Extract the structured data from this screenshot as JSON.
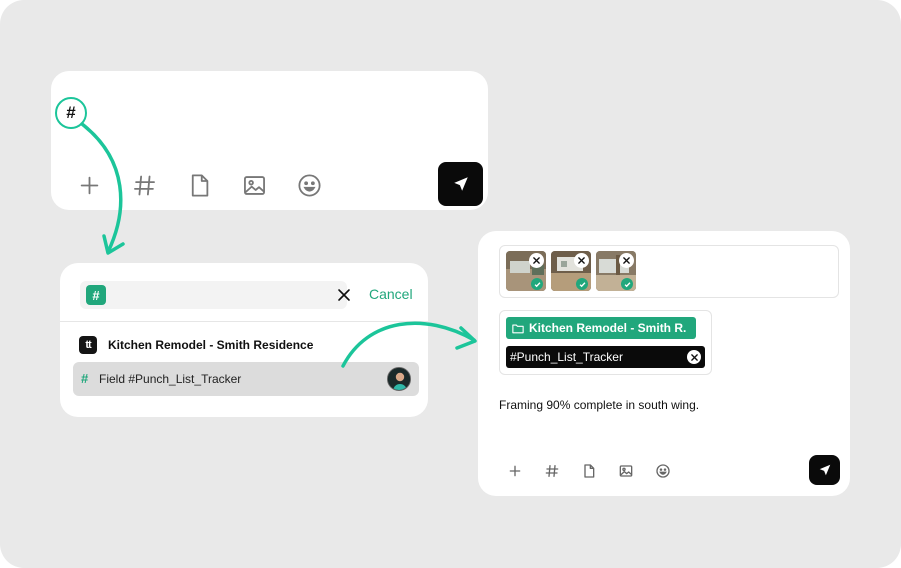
{
  "composer": {
    "trigger_symbol": "#",
    "toolbar": [
      "plus-icon",
      "hash-icon",
      "file-icon",
      "image-icon",
      "emoji-icon"
    ],
    "send_icon": "send-icon"
  },
  "search": {
    "hash_symbol": "#",
    "query": "",
    "placeholder": "",
    "cancel_label": "Cancel",
    "project": {
      "logo_text": "tt",
      "name": "Kitchen Remodel - Smith Residence"
    },
    "result": {
      "hash_symbol": "#",
      "label": "Field #Punch_List_Tracker"
    }
  },
  "message": {
    "attachments": [
      {
        "type": "photo",
        "status": "uploaded"
      },
      {
        "type": "photo",
        "status": "uploaded"
      },
      {
        "type": "photo",
        "status": "uploaded"
      }
    ],
    "project_tag": "Kitchen Remodel - Smith R.",
    "tracker_tag": "#Punch_List_Tracker",
    "text": "Framing 90% complete in south wing.",
    "toolbar": [
      "plus-icon",
      "hash-icon",
      "file-icon",
      "image-icon",
      "emoji-icon"
    ],
    "send_icon": "send-icon"
  },
  "colors": {
    "accent": "#21a77c",
    "arrow": "#1cc59a",
    "background": "#e9e9e9",
    "dark": "#0a0a0a"
  }
}
